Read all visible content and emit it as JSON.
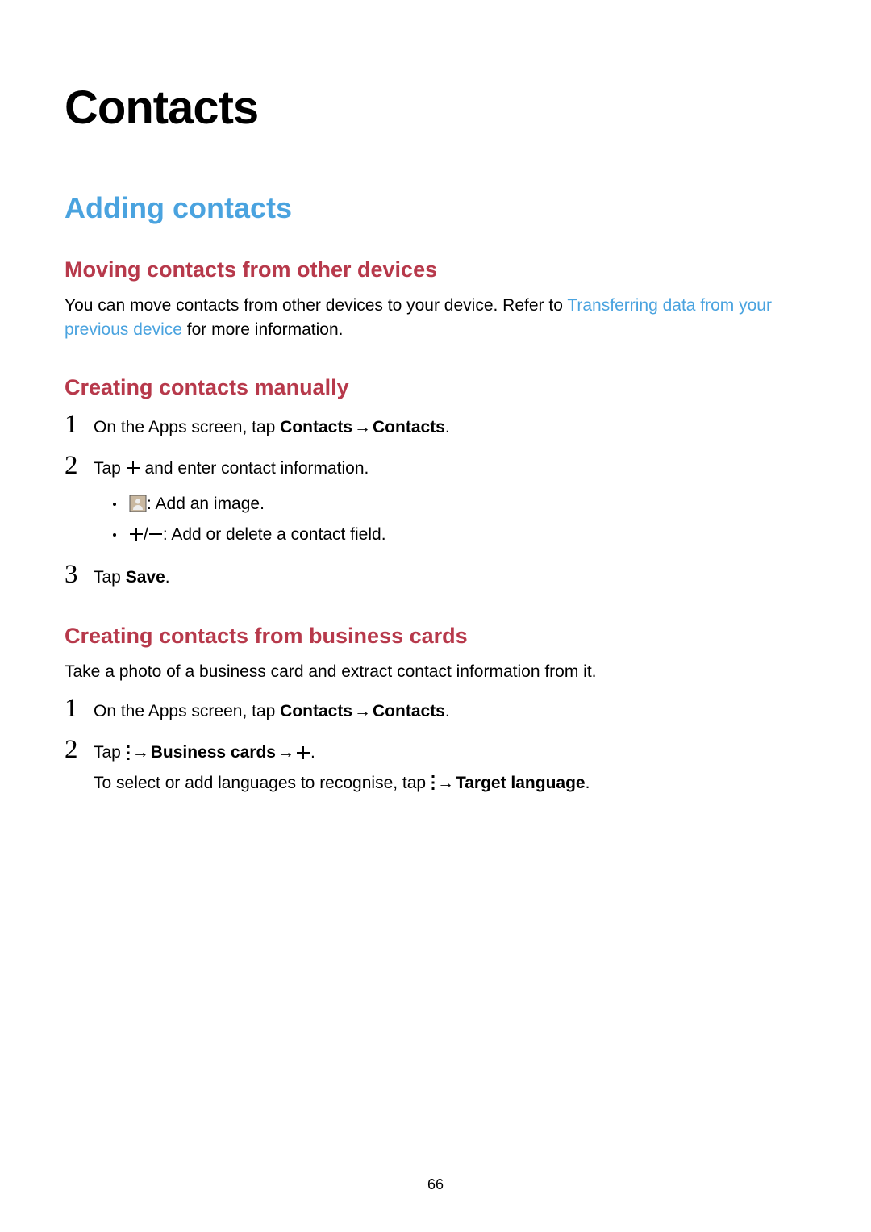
{
  "page_number": "66",
  "title": "Contacts",
  "section_heading": "Adding contacts",
  "sub1": {
    "heading": "Moving contacts from other devices",
    "para_pre": "You can move contacts from other devices to your device. Refer to ",
    "link_text": "Transferring data from your previous device",
    "para_post": " for more information."
  },
  "sub2": {
    "heading": "Creating contacts manually",
    "step1_pre": "On the Apps screen, tap ",
    "step1_b1": "Contacts",
    "step1_arrow": " → ",
    "step1_b2": "Contacts",
    "step1_post": ".",
    "step2_pre": "Tap ",
    "step2_post": " and enter contact information.",
    "bullet1_post": " : Add an image.",
    "bullet2_mid": " / ",
    "bullet2_post": " : Add or delete a contact field.",
    "step3_pre": "Tap ",
    "step3_b": "Save",
    "step3_post": "."
  },
  "sub3": {
    "heading": "Creating contacts from business cards",
    "para": "Take a photo of a business card and extract contact information from it.",
    "step1_pre": "On the Apps screen, tap ",
    "step1_b1": "Contacts",
    "step1_arrow": " → ",
    "step1_b2": "Contacts",
    "step1_post": ".",
    "step2_pre": "Tap ",
    "step2_arrow1": " → ",
    "step2_b1": "Business cards",
    "step2_arrow2": " → ",
    "step2_post": ".",
    "step2_l2_pre": "To select or add languages to recognise, tap ",
    "step2_l2_arrow": " → ",
    "step2_l2_b": "Target language",
    "step2_l2_post": "."
  },
  "nums": {
    "n1": "1",
    "n2": "2",
    "n3": "3"
  }
}
